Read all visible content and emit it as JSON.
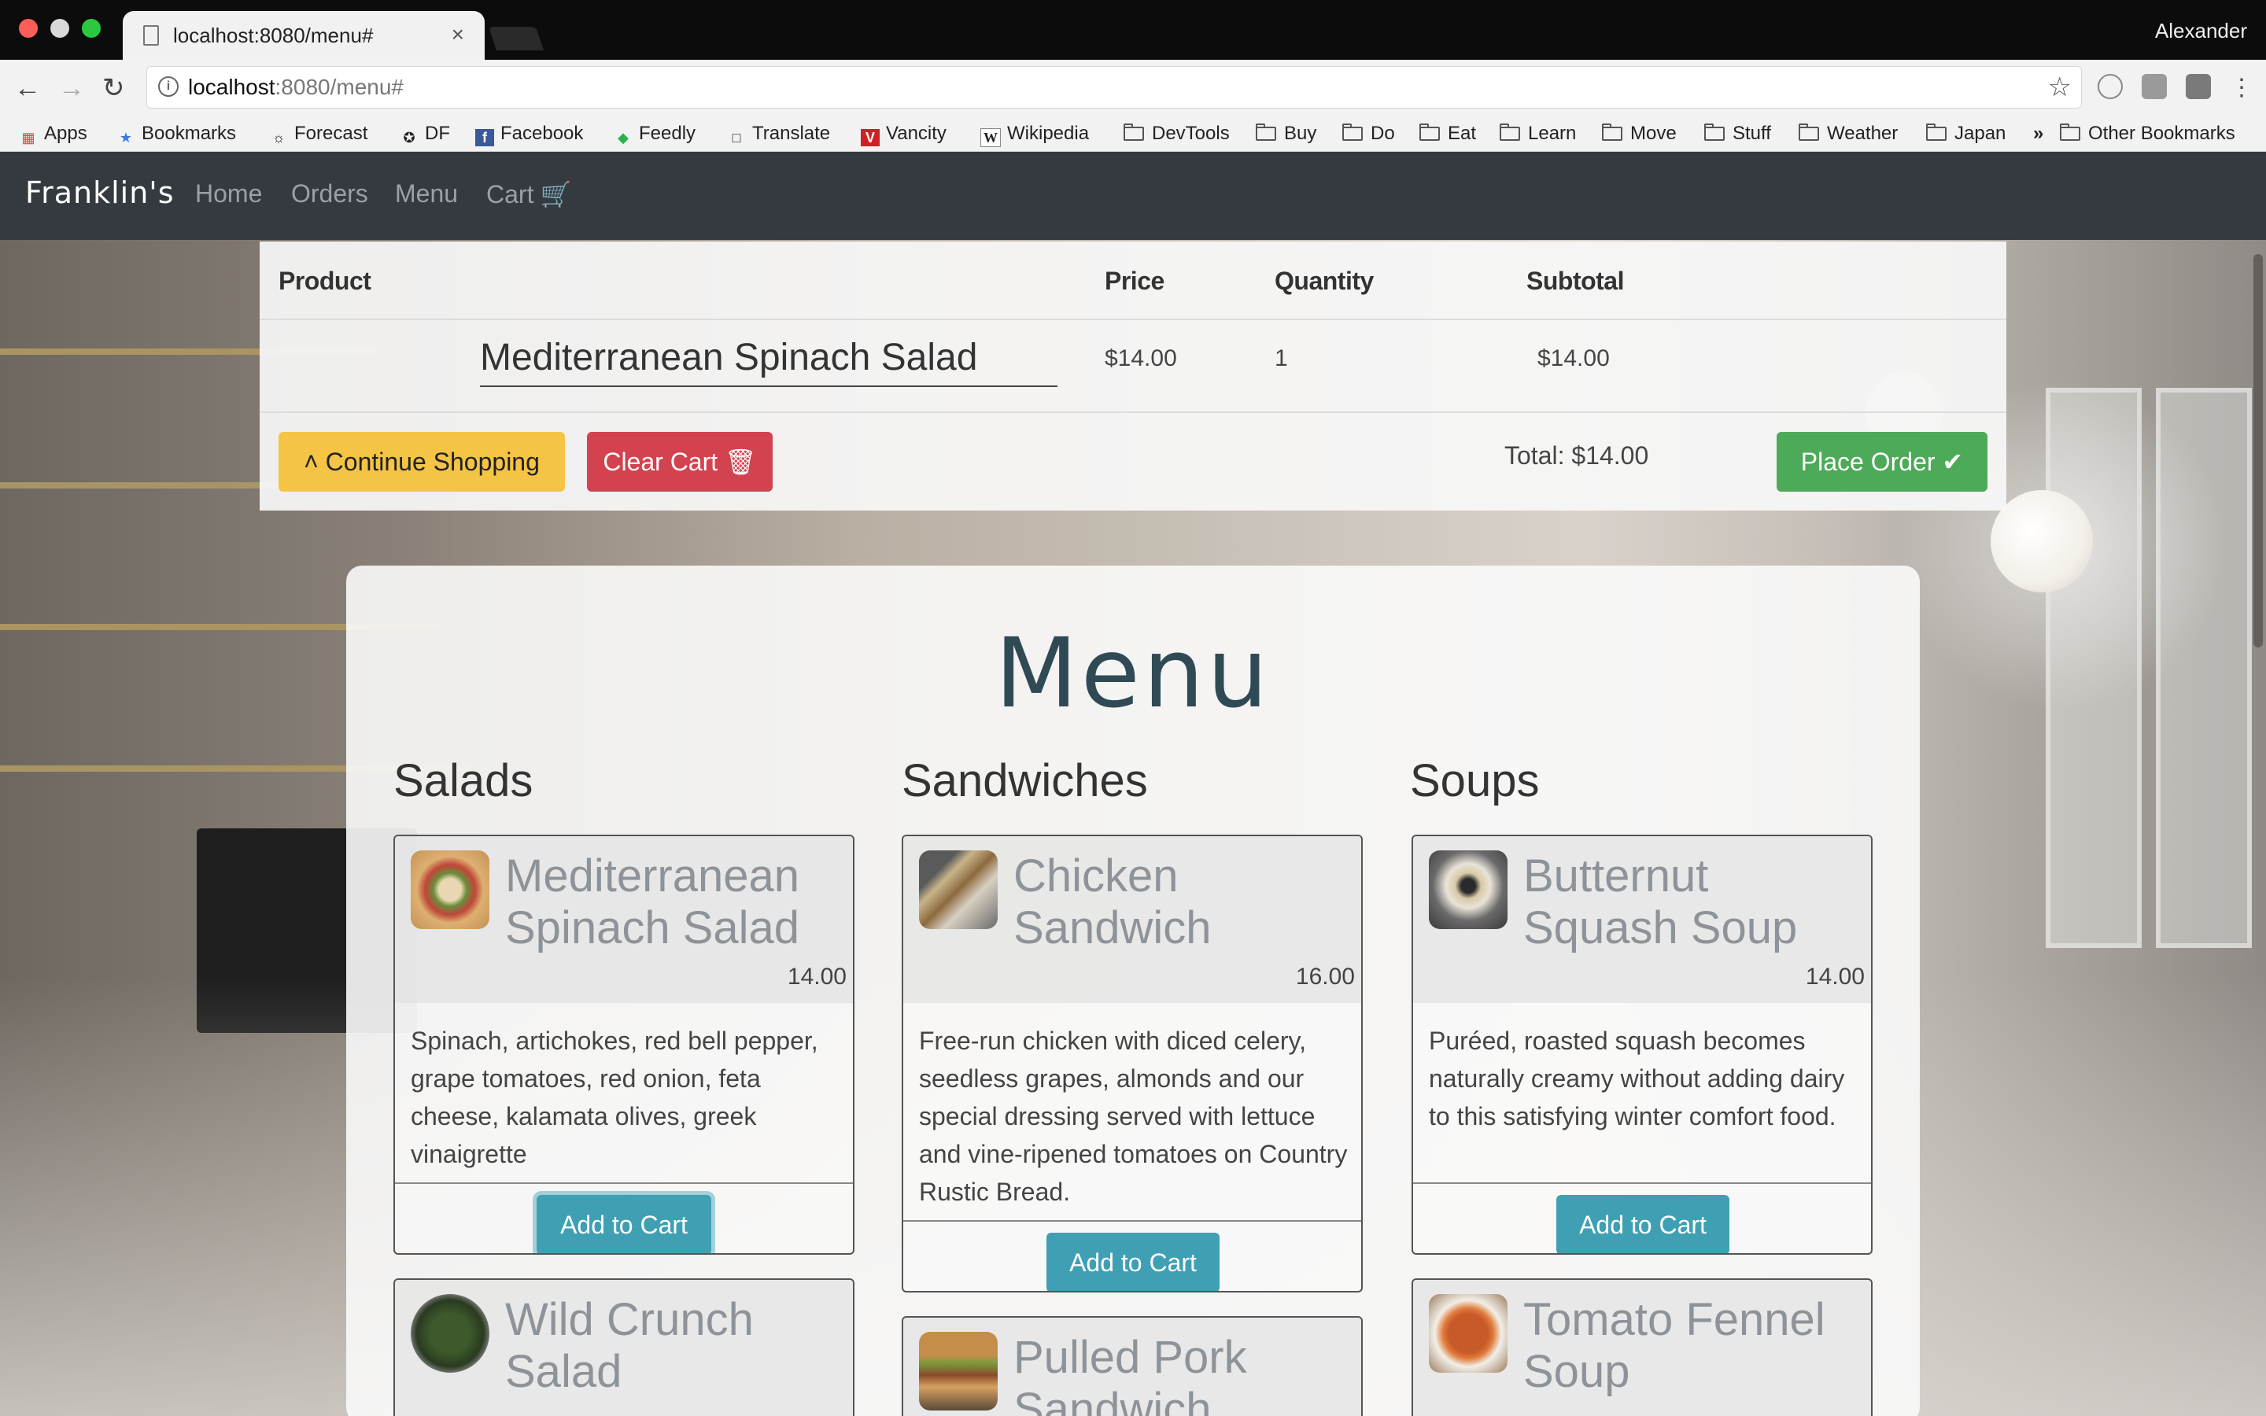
{
  "browser": {
    "tab_title": "localhost:8080/menu#",
    "tab_close": "×",
    "profile": "Alexander",
    "url_host": "localhost",
    "url_rest": ":8080/menu#",
    "bookmarks": [
      "Apps",
      "Bookmarks",
      "Forecast",
      "DF",
      "Facebook",
      "Feedly",
      "Translate",
      "Vancity",
      "Wikipedia",
      "DevTools",
      "Buy",
      "Do",
      "Eat",
      "Learn",
      "Move",
      "Stuff",
      "Weather",
      "Japan"
    ],
    "overflow": "»",
    "other_bookmarks": "Other Bookmarks"
  },
  "nav": {
    "brand": "Franklin's",
    "links": [
      "Home",
      "Orders",
      "Menu",
      "Cart"
    ]
  },
  "cart": {
    "headers": [
      "Product",
      "Price",
      "Quantity",
      "Subtotal"
    ],
    "items": [
      {
        "product": "Mediterranean Spinach Salad",
        "price": "$14.00",
        "quantity": "1",
        "subtotal": "$14.00"
      }
    ],
    "continue_label": "Continue Shopping",
    "clear_label": "Clear Cart",
    "total": "Total: $14.00",
    "place_label": "Place Order"
  },
  "menu": {
    "title": "Menu",
    "categories": [
      {
        "name": "Salads",
        "items": [
          {
            "name": "Mediterranean Spinach Salad",
            "price": "14.00",
            "description": "Spinach, artichokes, red bell pepper, grape tomatoes, red onion, feta cheese, kalamata olives, greek vinaigrette"
          },
          {
            "name": "Wild Crunch Salad"
          }
        ]
      },
      {
        "name": "Sandwiches",
        "items": [
          {
            "name": "Chicken Sandwich",
            "price": "16.00",
            "description": "Free-run chicken with diced celery, seedless grapes, almonds and our special dressing served with lettuce and vine-ripened tomatoes on Country Rustic Bread."
          },
          {
            "name": "Pulled Pork Sandwich"
          }
        ]
      },
      {
        "name": "Soups",
        "items": [
          {
            "name": "Butternut Squash Soup",
            "price": "14.00",
            "description": "Puréed, roasted squash becomes naturally creamy without adding dairy to this satisfying winter comfort food."
          },
          {
            "name": "Tomato Fennel Soup"
          }
        ]
      }
    ],
    "add_label": "Add to Cart"
  },
  "colors": {
    "navbar": "#343a40",
    "warning": "#f5c444",
    "danger": "#d3424f",
    "success": "#4daa58",
    "info": "#3fa0b4",
    "menu_title": "#2f4a55"
  }
}
